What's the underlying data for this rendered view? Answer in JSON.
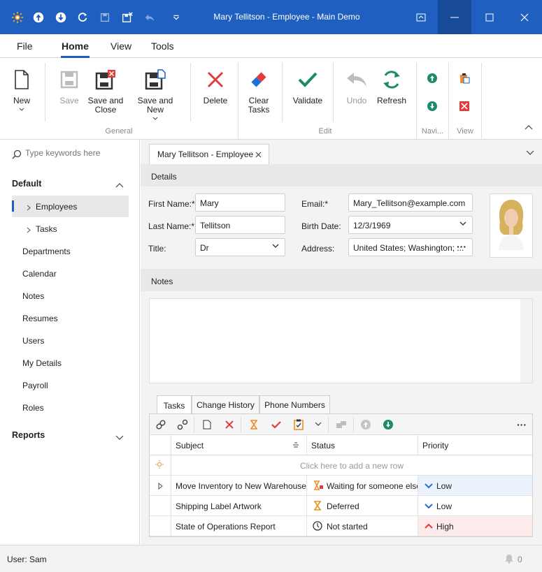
{
  "window": {
    "title": "Mary Tellitson - Employee - Main Demo"
  },
  "menu": {
    "file": "File",
    "home": "Home",
    "view": "View",
    "tools": "Tools"
  },
  "ribbon": {
    "new": "New",
    "save": "Save",
    "save_close": "Save and\nClose",
    "save_new": "Save and New",
    "delete": "Delete",
    "clear_tasks": "Clear\nTasks",
    "validate": "Validate",
    "undo": "Undo",
    "refresh": "Refresh",
    "group_general": "General",
    "group_edit": "Edit",
    "group_navi": "Navi...",
    "group_view": "View"
  },
  "sidebar": {
    "search_placeholder": "Type keywords here",
    "group_default": "Default",
    "group_reports": "Reports",
    "items": [
      "Employees",
      "Tasks",
      "Departments",
      "Calendar",
      "Notes",
      "Resumes",
      "Users",
      "My Details",
      "Payroll",
      "Roles"
    ]
  },
  "doc_tab": "Mary Tellitson - Employee",
  "details": {
    "section": "Details",
    "first_name_label": "First Name:*",
    "first_name": "Mary",
    "last_name_label": "Last Name:*",
    "last_name": "Tellitson",
    "title_label": "Title:",
    "title": "Dr",
    "email_label": "Email:*",
    "email": "Mary_Tellitson@example.com",
    "birth_label": "Birth Date:",
    "birth": "12/3/1969",
    "address_label": "Address:",
    "address": "United States; Washington; ..."
  },
  "notes": {
    "section": "Notes"
  },
  "bottom_tabs": [
    "Tasks",
    "Change History",
    "Phone Numbers"
  ],
  "grid": {
    "columns": [
      "Subject",
      "Status",
      "Priority"
    ],
    "new_row_hint": "Click here to add a new row",
    "rows": [
      {
        "subject": "Move Inventory to New Warehouse",
        "status": "Waiting for someone else",
        "priority": "Low"
      },
      {
        "subject": "Shipping Label Artwork",
        "status": "Deferred",
        "priority": "Low"
      },
      {
        "subject": "State of Operations Report",
        "status": "Not started",
        "priority": "High"
      }
    ]
  },
  "status": {
    "user": "User: Sam",
    "notifications": "0"
  },
  "colors": {
    "accent": "#1f5fbf",
    "green": "#1d8a6b",
    "red": "#e03c3c",
    "orange": "#e8922a"
  }
}
